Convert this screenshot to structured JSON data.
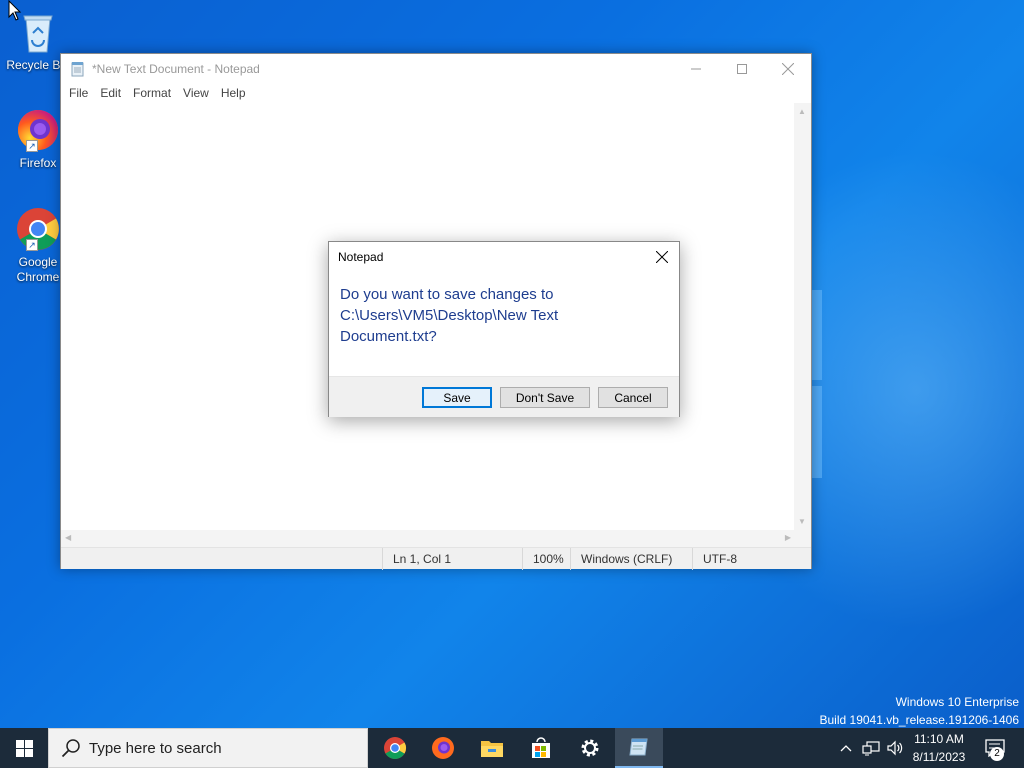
{
  "desktop": {
    "icons": [
      {
        "label": "Recycle Bin"
      },
      {
        "label": "Firefox"
      },
      {
        "label": "Google Chrome"
      }
    ],
    "watermark": {
      "line1": "Windows 10 Enterprise",
      "line2": "Build 19041.vb_release.191206-1406"
    }
  },
  "notepad": {
    "title": "*New Text Document - Notepad",
    "menu": [
      "File",
      "Edit",
      "Format",
      "View",
      "Help"
    ],
    "status": {
      "position": "Ln 1, Col 1",
      "zoom": "100%",
      "line_ending": "Windows (CRLF)",
      "encoding": "UTF-8"
    }
  },
  "dialog": {
    "title": "Notepad",
    "message_line1": "Do you want to save changes to",
    "message_line2": "C:\\Users\\VM5\\Desktop\\New Text",
    "message_line3": "Document.txt?",
    "buttons": {
      "save": "Save",
      "dont_save": "Don't Save",
      "cancel": "Cancel"
    }
  },
  "taskbar": {
    "search_placeholder": "Type here to search",
    "apps": [
      "chrome-icon",
      "firefox-icon",
      "file-explorer-icon",
      "store-icon",
      "settings-icon",
      "notepad-icon"
    ],
    "clock": {
      "time": "11:10 AM",
      "date": "8/11/2023"
    },
    "notification_count": "2"
  }
}
